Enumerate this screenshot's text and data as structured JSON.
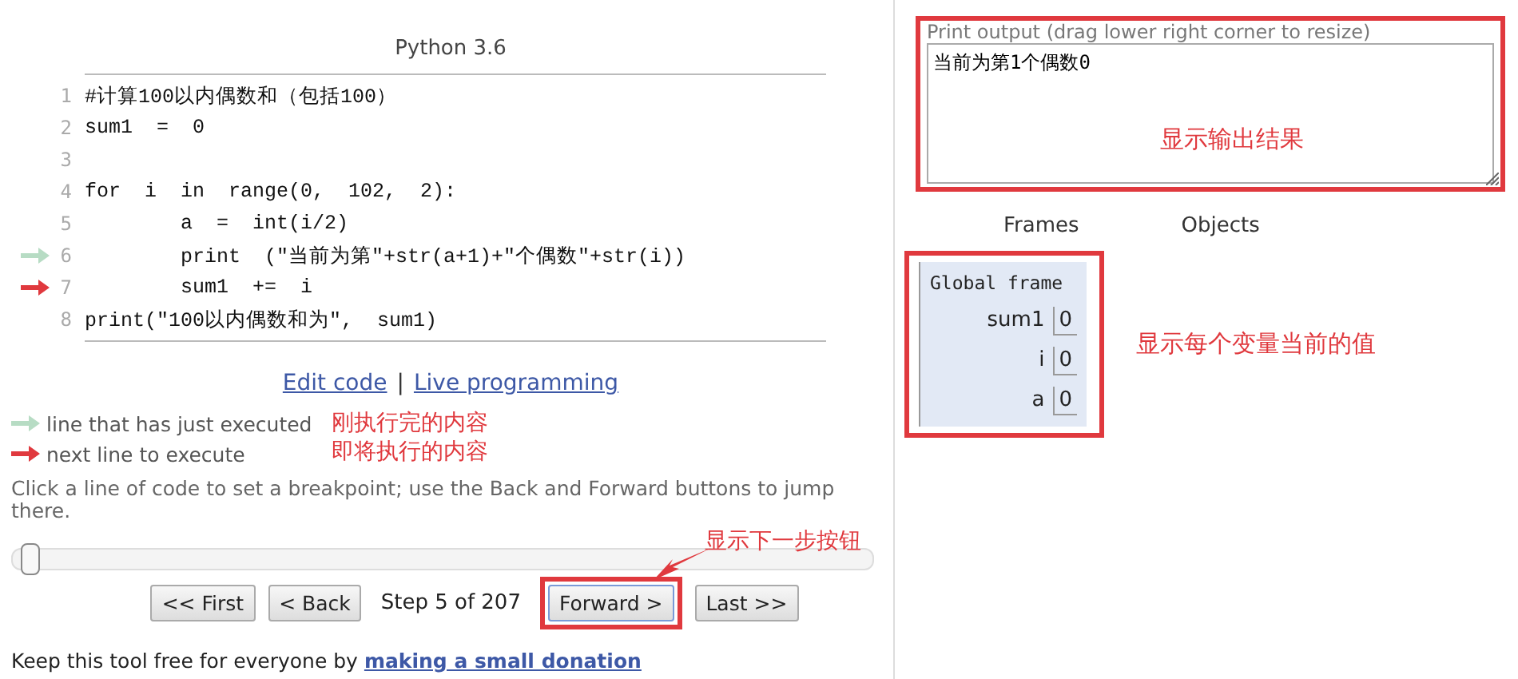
{
  "title": "Python 3.6",
  "code_lines": [
    {
      "number": "1",
      "text": "#计算100以内偶数和（包括100）",
      "just_executed": false,
      "next": false
    },
    {
      "number": "2",
      "text": "sum1  =  0",
      "just_executed": false,
      "next": false
    },
    {
      "number": "3",
      "just_executed": false,
      "next": false
    },
    {
      "number": "4",
      "text": "for  i  in  range(0,  102,  2):",
      "just_executed": false,
      "next": false
    },
    {
      "number": "5",
      "text": "        a  =  int(i/2)",
      "just_executed": false,
      "next": false
    },
    {
      "number": "6",
      "text": "        print  (″当前为第″+str(a+1)+″个偶数″+str(i))",
      "just_executed": true,
      "next": false
    },
    {
      "number": "7",
      "text": "        sum1  +=  i",
      "just_executed": false,
      "next": true
    },
    {
      "number": "8",
      "text": "print(″100以内偶数和为″,  sum1)",
      "just_executed": false,
      "next": false
    }
  ],
  "edit_link": "Edit code",
  "separator": "|",
  "live_link": "Live programming",
  "legend": [
    {
      "kind": "executed",
      "label": "line that has just executed"
    },
    {
      "kind": "next",
      "label": "next line to execute"
    }
  ],
  "legend_annotations": [
    "刚执行完的内容",
    "即将执行的内容"
  ],
  "hint": "Click a line of code to set a breakpoint; use the Back and Forward buttons to jump there.",
  "slider": {
    "level": 0.02
  },
  "nav": [
    {
      "kind": "button",
      "label": "<< First",
      "highlighted": false
    },
    {
      "kind": "button",
      "label": "< Back",
      "highlighted": false
    },
    {
      "kind": "text",
      "label": "Step 5 of 207"
    },
    {
      "kind": "button",
      "label": "Forward >",
      "highlighted": true
    },
    {
      "kind": "button",
      "label": "Last >>",
      "highlighted": false
    }
  ],
  "nav_annotation": "显示下一步按钮",
  "footer": {
    "text": "Keep this tool free for everyone by",
    "link": "making a small donation"
  },
  "output": {
    "label": "Print output (drag lower right corner to resize)",
    "value": "当前为第1个偶数0",
    "annotation": "显示输出结果"
  },
  "headers": [
    "Frames",
    "Objects"
  ],
  "frame": {
    "title": "Global frame",
    "variables": [
      {
        "name": "sum1",
        "value": "0"
      },
      {
        "name": "i",
        "value": "0"
      },
      {
        "name": "a",
        "value": "0"
      }
    ],
    "annotation": "显示每个变量当前的值"
  }
}
